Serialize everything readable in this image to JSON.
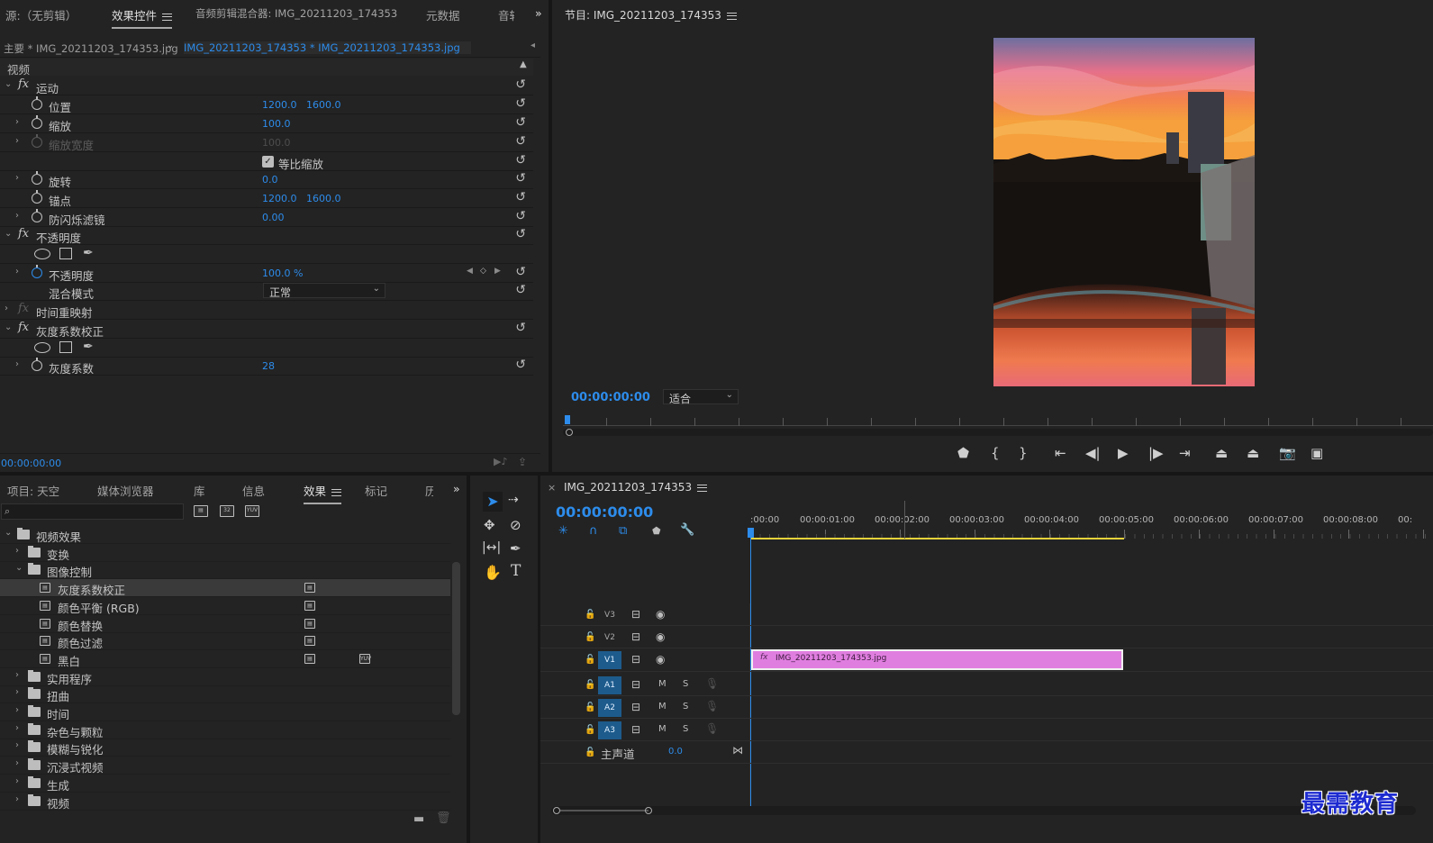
{
  "effect_controls": {
    "tabs": [
      "源:（无剪辑）",
      "效果控件",
      "音频剪辑混合器: IMG_20211203_174353",
      "元数据",
      "音轨"
    ],
    "master_label": "主要 * IMG_20211203_174353.jpg",
    "clip_label": "IMG_20211203_174353 * IMG_20211203_174353.jpg",
    "section_video": "视频",
    "motion": "运动",
    "position": "位置",
    "position_x": "1200.0",
    "position_y": "1600.0",
    "scale": "缩放",
    "scale_val": "100.0",
    "scale_width": "缩放宽度",
    "scale_width_val": "100.0",
    "uniform_scale": "等比缩放",
    "rotation": "旋转",
    "rotation_val": "0.0",
    "anchor": "锚点",
    "anchor_x": "1200.0",
    "anchor_y": "1600.0",
    "flicker": "防闪烁滤镜",
    "flicker_val": "0.00",
    "opacity_group": "不透明度",
    "opacity": "不透明度",
    "opacity_val": "100.0 %",
    "blend_mode": "混合模式",
    "blend_val": "正常",
    "time_remap": "时间重映射",
    "gamma_group": "灰度系数校正",
    "gamma": "灰度系数",
    "gamma_val": "28",
    "timecode": "00:00:00:00"
  },
  "program": {
    "title": "节目: IMG_20211203_174353",
    "timecode": "00:00:00:00",
    "fit": "适合"
  },
  "project": {
    "tabs": [
      "项目: 天空",
      "媒体浏览器",
      "库",
      "信息",
      "效果",
      "标记",
      "历"
    ],
    "tree": [
      {
        "label": "视频效果",
        "level": 0,
        "open": true
      },
      {
        "label": "变换",
        "level": 1,
        "open": false
      },
      {
        "label": "图像控制",
        "level": 1,
        "open": true
      },
      {
        "label": "灰度系数校正",
        "level": 2,
        "effect": true,
        "selected": true
      },
      {
        "label": "颜色平衡 (RGB)",
        "level": 2,
        "effect": true
      },
      {
        "label": "颜色替换",
        "level": 2,
        "effect": true
      },
      {
        "label": "颜色过滤",
        "level": 2,
        "effect": true
      },
      {
        "label": "黑白",
        "level": 2,
        "effect": true,
        "yuv": true
      },
      {
        "label": "实用程序",
        "level": 1,
        "open": false
      },
      {
        "label": "扭曲",
        "level": 1,
        "open": false
      },
      {
        "label": "时间",
        "level": 1,
        "open": false
      },
      {
        "label": "杂色与颗粒",
        "level": 1,
        "open": false
      },
      {
        "label": "模糊与锐化",
        "level": 1,
        "open": false
      },
      {
        "label": "沉浸式视频",
        "level": 1,
        "open": false
      },
      {
        "label": "生成",
        "level": 1,
        "open": false
      },
      {
        "label": "视频",
        "level": 1,
        "open": false
      }
    ]
  },
  "timeline": {
    "sequence": "IMG_20211203_174353",
    "timecode": "00:00:00:00",
    "ruler": [
      ":00:00",
      "00:00:01:00",
      "00:00:02:00",
      "00:00:03:00",
      "00:00:04:00",
      "00:00:05:00",
      "00:00:06:00",
      "00:00:07:00",
      "00:00:08:00",
      "00:"
    ],
    "video_tracks": [
      "V3",
      "V2",
      "V1"
    ],
    "audio_tracks": [
      "A1",
      "A2",
      "A3"
    ],
    "mute": "M",
    "solo": "S",
    "master": "主声道",
    "master_val": "0.0",
    "clip": "IMG_20211203_174353.jpg",
    "clip_color": "#e07ee0"
  },
  "watermark": "最需教育"
}
